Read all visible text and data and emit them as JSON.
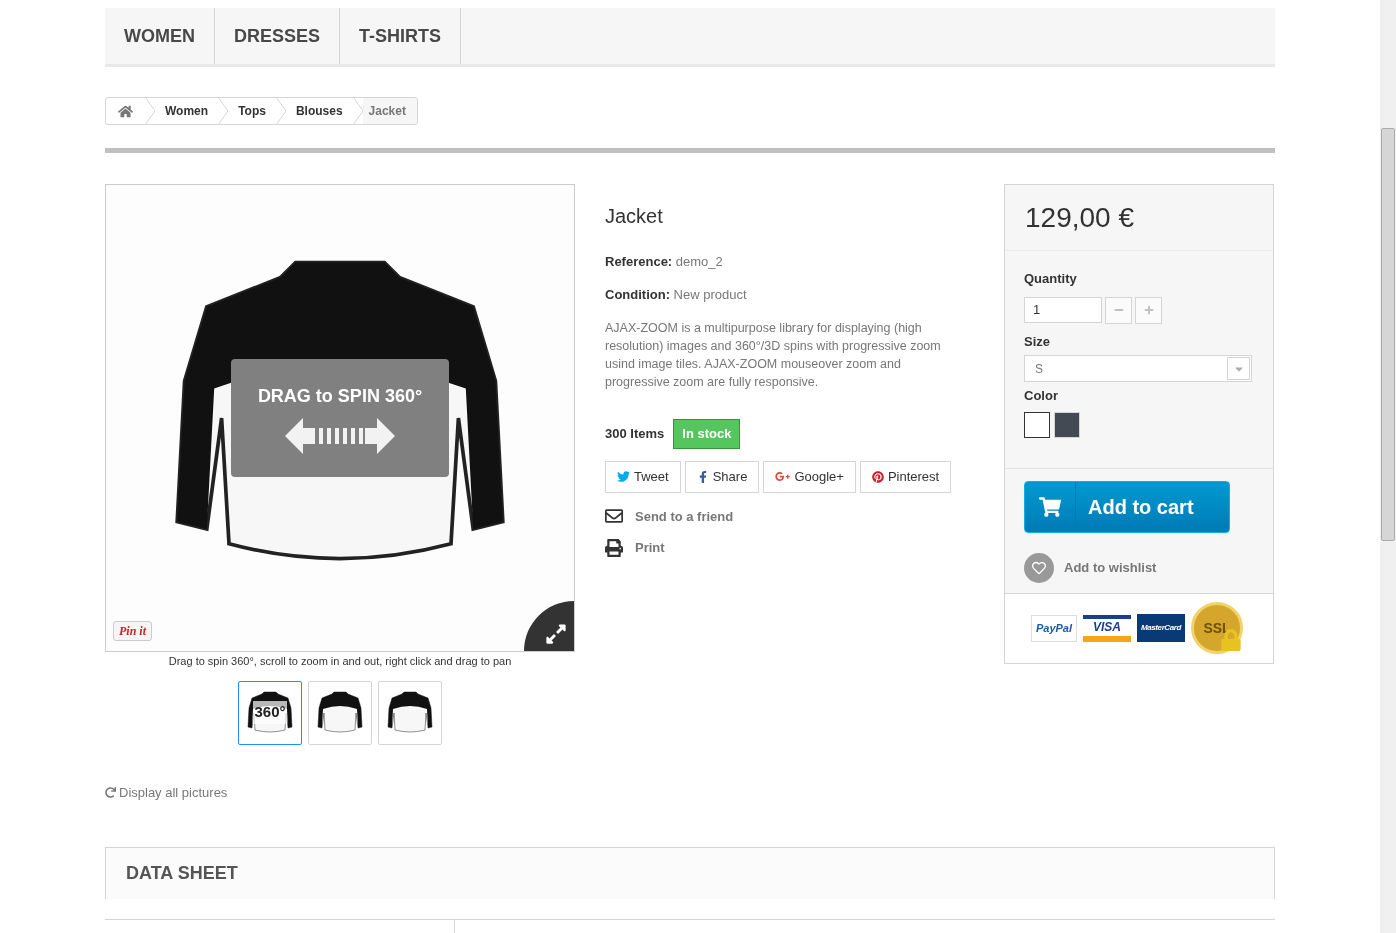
{
  "menu": [
    {
      "label": "WOMEN"
    },
    {
      "label": "DRESSES"
    },
    {
      "label": "T-SHIRTS"
    }
  ],
  "breadcrumb": {
    "items": [
      "Women",
      "Tops",
      "Blouses"
    ],
    "current": "Jacket"
  },
  "viewer": {
    "overlay_text": "DRAG to SPIN 360°",
    "pin_label": "Pin it",
    "caption": "Drag to spin 360°, scroll to zoom in and out, right click and drag to pan",
    "thumbnails": [
      {
        "kind": "spin",
        "label": "360°",
        "selected": true
      },
      {
        "kind": "front",
        "selected": false
      },
      {
        "kind": "back",
        "selected": false
      }
    ],
    "display_all": "Display all pictures"
  },
  "product": {
    "title": "Jacket",
    "reference_label": "Reference:",
    "reference": "demo_2",
    "condition_label": "Condition:",
    "condition": "New product",
    "description": "AJAX-ZOOM is a multipurpose library for displaying (high resolution) images and 360°/3D spins with progressive zoom usind image tiles. AJAX-ZOOM mouseover zoom and progressive zoom are fully responsive.",
    "quantity_available": "300 Items",
    "availability": "In stock",
    "share_buttons": [
      {
        "kind": "twitter",
        "label": "Tweet"
      },
      {
        "kind": "facebook",
        "label": "Share"
      },
      {
        "kind": "google",
        "label": "Google+"
      },
      {
        "kind": "pinterest",
        "label": "Pinterest"
      }
    ],
    "actions": [
      {
        "kind": "email",
        "label": "Send to a friend"
      },
      {
        "kind": "print",
        "label": "Print"
      }
    ]
  },
  "buy_box": {
    "price": "129,00 €",
    "quantity_label": "Quantity",
    "quantity": "1",
    "size_label": "Size",
    "size": "S",
    "color_label": "Color",
    "colors": [
      {
        "color": "#ffffff",
        "selected": true
      },
      {
        "color": "#434a54",
        "selected": false
      }
    ],
    "add_to_cart": "Add to cart",
    "wishlist": "Add to wishlist",
    "payment_logos": [
      {
        "kind": "paypal",
        "label": "PayPal"
      },
      {
        "kind": "visa",
        "label": "VISA"
      },
      {
        "kind": "mastercard",
        "label": "MasterCard"
      },
      {
        "kind": "ssl",
        "label": "SSL"
      }
    ]
  },
  "data_sheet": {
    "title": "DATA SHEET"
  }
}
